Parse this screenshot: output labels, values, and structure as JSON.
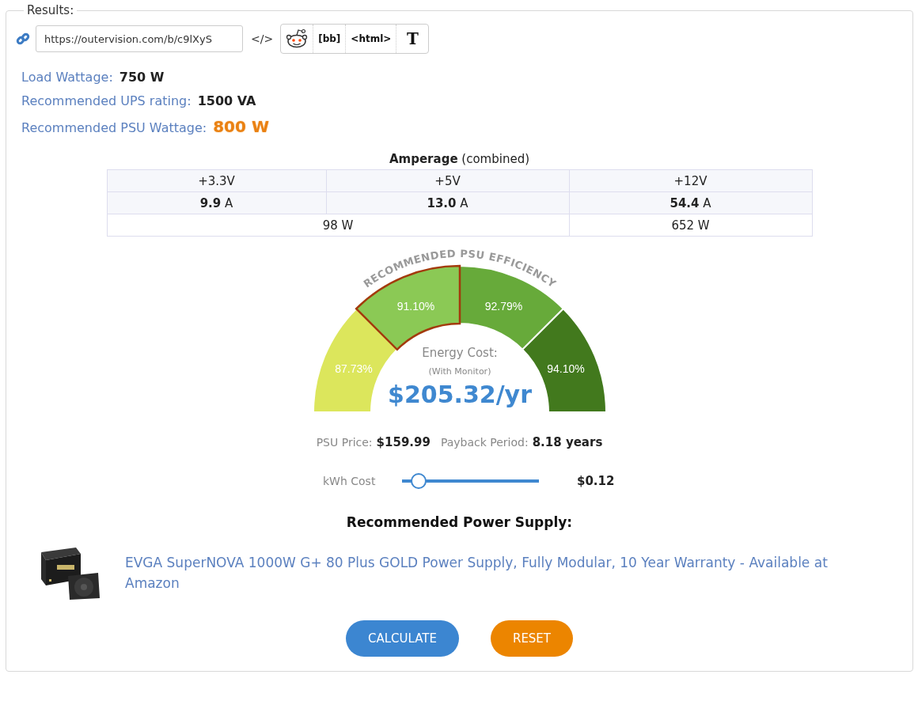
{
  "fieldset": {
    "legend": "Results:"
  },
  "share": {
    "url": "https://outervision.com/b/c9lXyS",
    "embed_label": "</>",
    "buttons": [
      {
        "kind": "reddit"
      },
      {
        "kind": "text",
        "label": "[bb]"
      },
      {
        "kind": "text",
        "label": "<html>"
      },
      {
        "kind": "serif",
        "label": "T"
      }
    ]
  },
  "summary": [
    {
      "label": "Load Wattage:",
      "value": "750 W",
      "highlight": false
    },
    {
      "label": "Recommended UPS rating:",
      "value": "1500 VA",
      "highlight": false
    },
    {
      "label": "Recommended PSU Wattage:",
      "value": "800 W",
      "highlight": true
    }
  ],
  "amperage": {
    "title": "**Amperage** (combined)",
    "rails": [
      "+3.3V",
      "+5V",
      "+12V"
    ],
    "currents": [
      "**9.9** A",
      "**13.0** A",
      "**54.4** A"
    ],
    "watts": [
      {
        "text": "98 W",
        "kind": "wide"
      },
      {
        "text": "652 W",
        "kind": "single"
      }
    ]
  },
  "gauge": {
    "title": "RECOMMENDED PSU EFFICIENCY",
    "segments": [
      {
        "label": "87.73%",
        "color": "#dce65c",
        "selected": false
      },
      {
        "label": "91.10%",
        "color": "#8bc955",
        "selected": true
      },
      {
        "label": "92.79%",
        "color": "#67aa3a",
        "selected": false
      },
      {
        "label": "94.10%",
        "color": "#42791d",
        "selected": false
      }
    ],
    "cost_label": "Energy Cost:",
    "cost_note": "(With Monitor)",
    "cost": "$205.32/yr"
  },
  "price": {
    "psu_label": "PSU Price:",
    "psu_value": "$159.99",
    "payback_label": "Payback Period:",
    "payback_value": "8.18 years"
  },
  "kwh": {
    "label": "kWh Cost",
    "level": 0.16,
    "value": "$0.12"
  },
  "recommendation": {
    "heading": "Recommended Power Supply:",
    "link": "EVGA SuperNOVA 1000W G+ 80 Plus GOLD Power Supply, Fully Modular, 10 Year Warranty - Available at Amazon"
  },
  "buttons": [
    {
      "label": "CALCULATE",
      "kind": "primary"
    },
    {
      "label": "RESET",
      "kind": "reset"
    }
  ]
}
